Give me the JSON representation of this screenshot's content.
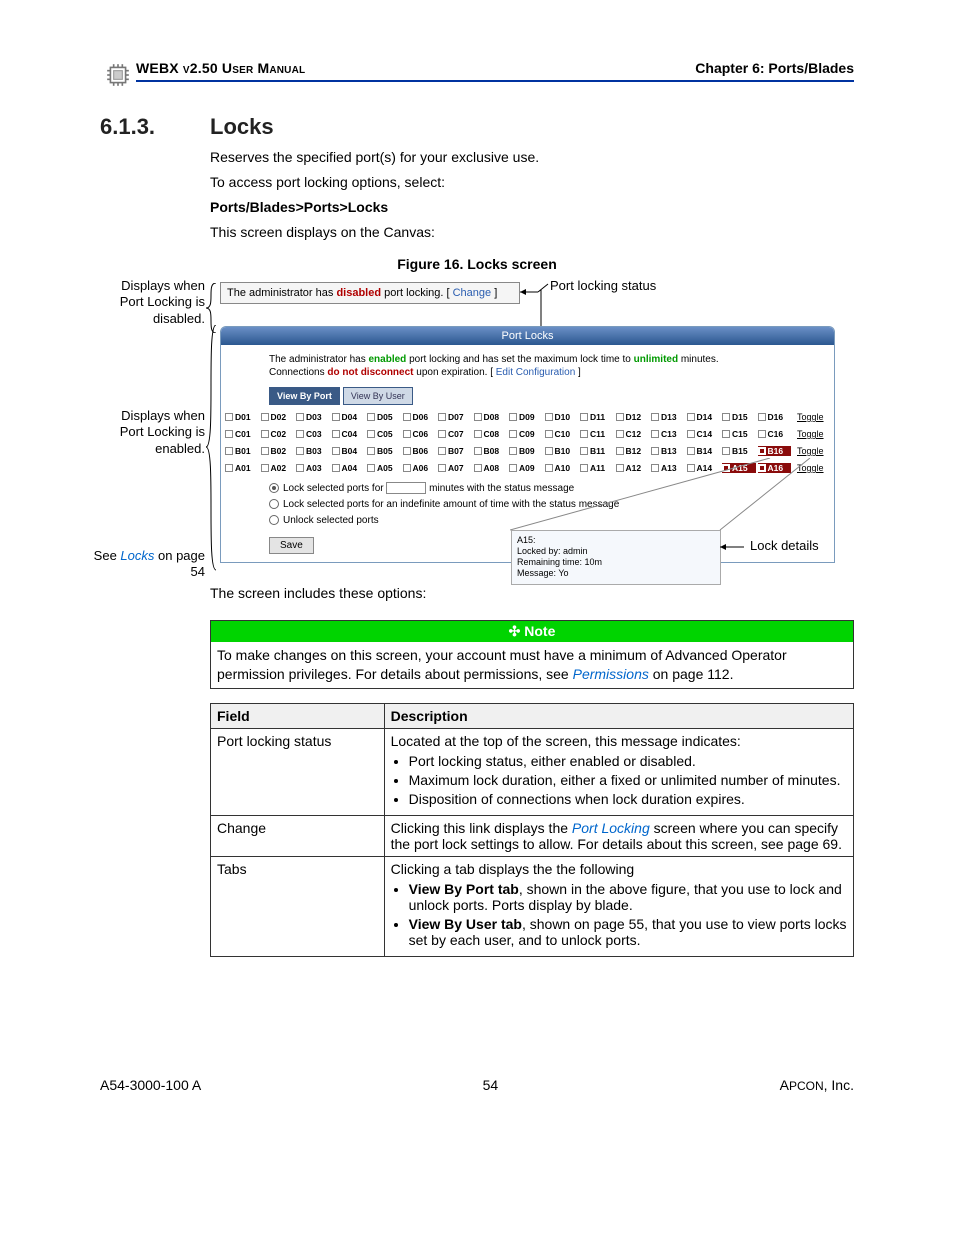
{
  "header": {
    "left": "WEBX v2.50 User Manual",
    "right": "Chapter 6: Ports/Blades"
  },
  "section": {
    "number": "6.1.3.",
    "title": "Locks",
    "p1": "Reserves the specified port(s) for your exclusive use.",
    "p2": "To access port locking options, select:",
    "path": "Ports/Blades>Ports>Locks",
    "p3": "This screen displays on the Canvas:",
    "p_after": "The screen includes these options:"
  },
  "figure": {
    "caption": "Figure 16. Locks screen",
    "callouts": {
      "disabled": "Displays when Port Locking is disabled.",
      "enabled": "Displays when Port Locking is enabled.",
      "see_locks_pre": "See ",
      "see_locks_link": "Locks",
      "see_locks_post": " on page 54",
      "status": "Port locking status",
      "lock_details": "Lock details"
    },
    "disabled_bar": {
      "pre": "The administrator has ",
      "word": "disabled",
      "post": " port locking. [ ",
      "link": "Change",
      "post2": " ]"
    },
    "panel": {
      "title": "Port Locks",
      "intro_pre": "The administrator has ",
      "intro_word": "enabled",
      "intro_mid": " port locking and has set the maximum lock time to ",
      "intro_unl": "unlimited",
      "intro_post": " minutes.",
      "intro_line2_pre": "Connections ",
      "intro_line2_word": "do not disconnect",
      "intro_line2_post": " upon expiration. [ ",
      "intro_link": "Edit Configuration",
      "intro_line2_end": " ]",
      "tab_port": "View By Port",
      "tab_user": "View By User",
      "toggle": "Toggle",
      "row_prefixes": [
        "D",
        "C",
        "B",
        "A"
      ],
      "locked_b": [
        "B16"
      ],
      "locked_a": [
        "A15",
        "A16"
      ],
      "opt1_pre": "Lock selected ports for ",
      "opt1_post": " minutes with the status message ",
      "opt2": "Lock selected ports for an indefinite amount of time with the status message ",
      "opt3": "Unlock selected ports",
      "save": "Save"
    },
    "tooltip": {
      "l1": "A15:",
      "l2": "Locked by: admin",
      "l3": "Remaining time: 10m",
      "l4": "Message: Yo"
    }
  },
  "note": {
    "bar": "Note",
    "bar_icon": "✣",
    "body_pre": "To make changes on this screen, your account must have a minimum of Advanced Operator permission privileges. For details about permissions, see ",
    "body_link": "Permissions",
    "body_post": " on page 112."
  },
  "table": {
    "h1": "Field",
    "h2": "Description",
    "r1_field": "Port locking status",
    "r1_lead": "Located at the top of the screen, this message indicates:",
    "r1_b1": "Port locking status, either enabled or disabled.",
    "r1_b2": "Maximum lock duration, either a fixed or unlimited number of minutes.",
    "r1_b3": "Disposition of connections when lock duration expires.",
    "r2_field": "Change",
    "r2_pre": "Clicking this link displays the ",
    "r2_link": "Port Locking",
    "r2_post": " screen where you can specify the port lock settings to allow. For details about this screen, see page 69.",
    "r3_field": "Tabs",
    "r3_lead": "Clicking a tab displays the the following",
    "r3_b1_bold": "View By Port tab",
    "r3_b1_rest": ", shown in the above figure, that you use to lock and unlock ports. Ports display by blade.",
    "r3_b2_bold": "View By User tab",
    "r3_b2_rest": ", shown on page 55, that you use to view ports locks set by each user, and to unlock ports."
  },
  "footer": {
    "left": "A54-3000-100 A",
    "center": "54",
    "right_pre": "A",
    "right_sc": "PCON",
    "right_post": ", Inc."
  }
}
